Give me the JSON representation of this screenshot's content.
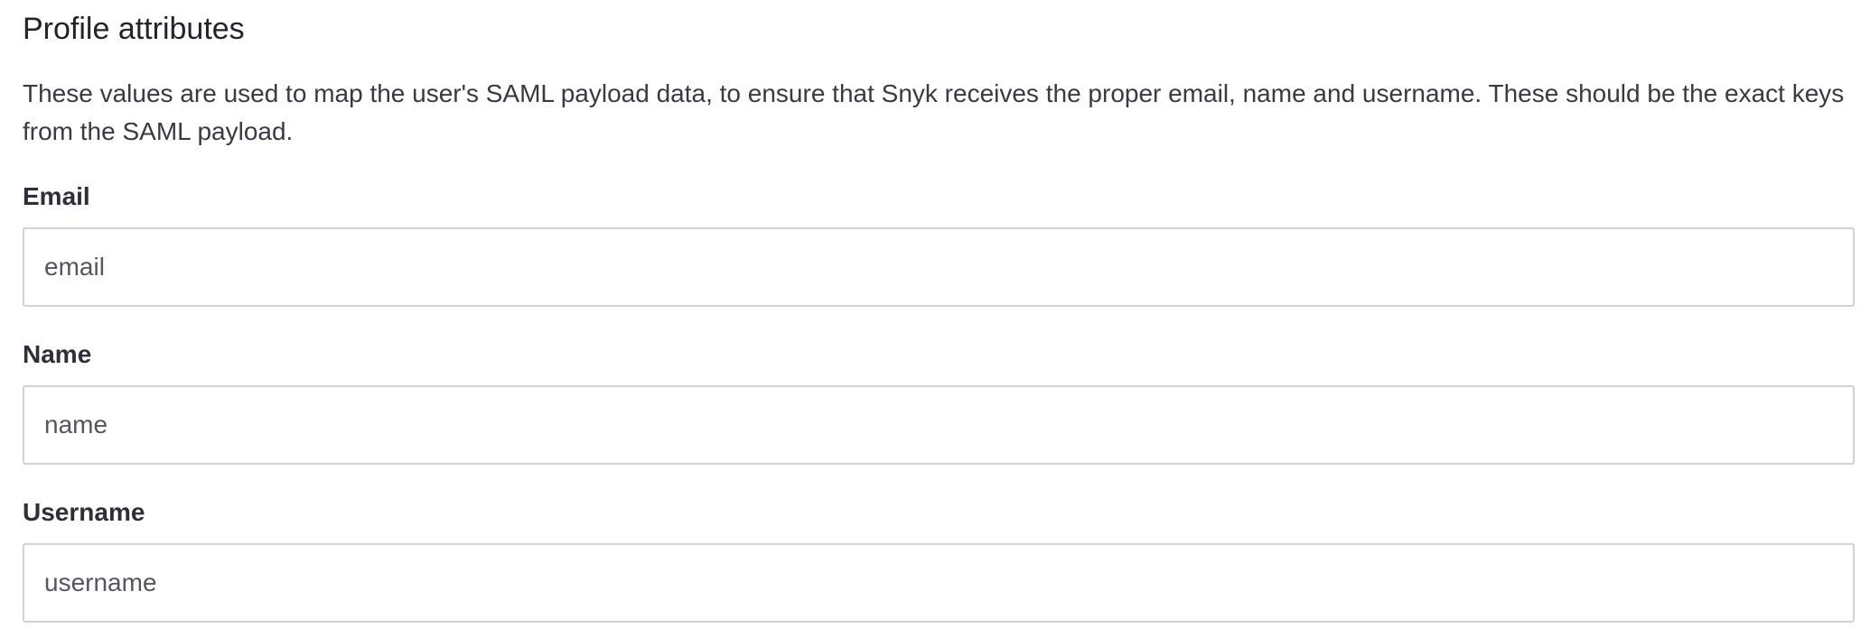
{
  "section": {
    "title": "Profile attributes",
    "description": "These values are used to map the user's SAML payload data, to ensure that Snyk receives the proper email, name and username. These should be the exact keys from the SAML payload."
  },
  "fields": [
    {
      "label": "Email",
      "value": "",
      "placeholder": "email"
    },
    {
      "label": "Name",
      "value": "",
      "placeholder": "name"
    },
    {
      "label": "Username",
      "value": "",
      "placeholder": "username"
    }
  ]
}
